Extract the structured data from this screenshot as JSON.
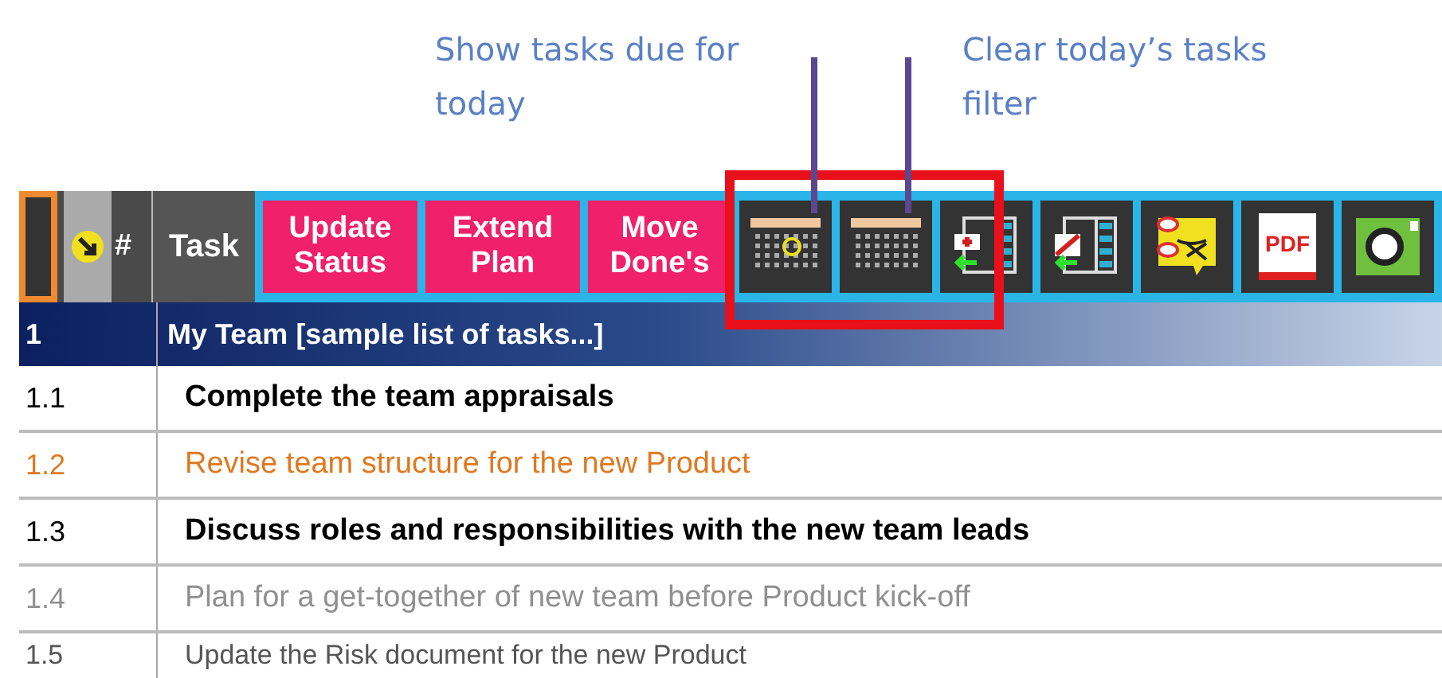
{
  "callouts": [
    {
      "text": "Show tasks due for today"
    },
    {
      "text": "Clear today’s tasks filter"
    }
  ],
  "toolbar": {
    "number_header": "#",
    "task_header": "Task",
    "buttons": [
      {
        "label": "Update Status"
      },
      {
        "label": "Extend Plan"
      },
      {
        "label": "Move Done's"
      }
    ],
    "icon_buttons": [
      {
        "kind": "calendar-today"
      },
      {
        "kind": "calendar"
      },
      {
        "kind": "sheet-add"
      },
      {
        "kind": "sheet-remove"
      },
      {
        "kind": "note-cross"
      },
      {
        "kind": "pdf",
        "label": "PDF"
      },
      {
        "kind": "camera"
      }
    ]
  },
  "group": {
    "number": "1",
    "title": "My Team [sample list of tasks...]"
  },
  "rows": [
    {
      "number": "1.1",
      "task": "Complete the team appraisals",
      "color": "#000000",
      "bold": true
    },
    {
      "number": "1.2",
      "task": "Revise team structure for the new Product",
      "color": "#e07820",
      "bold": false
    },
    {
      "number": "1.3",
      "task": "Discuss roles and responsibilities with the new team leads",
      "color": "#000000",
      "bold": true
    },
    {
      "number": "1.4",
      "task": "Plan for a get-together of new team before Product kick-off",
      "color": "#909090",
      "bold": false
    },
    {
      "number": "1.5",
      "task": "Update the Risk document for the new Product",
      "color": "#555555",
      "bold": false
    }
  ]
}
